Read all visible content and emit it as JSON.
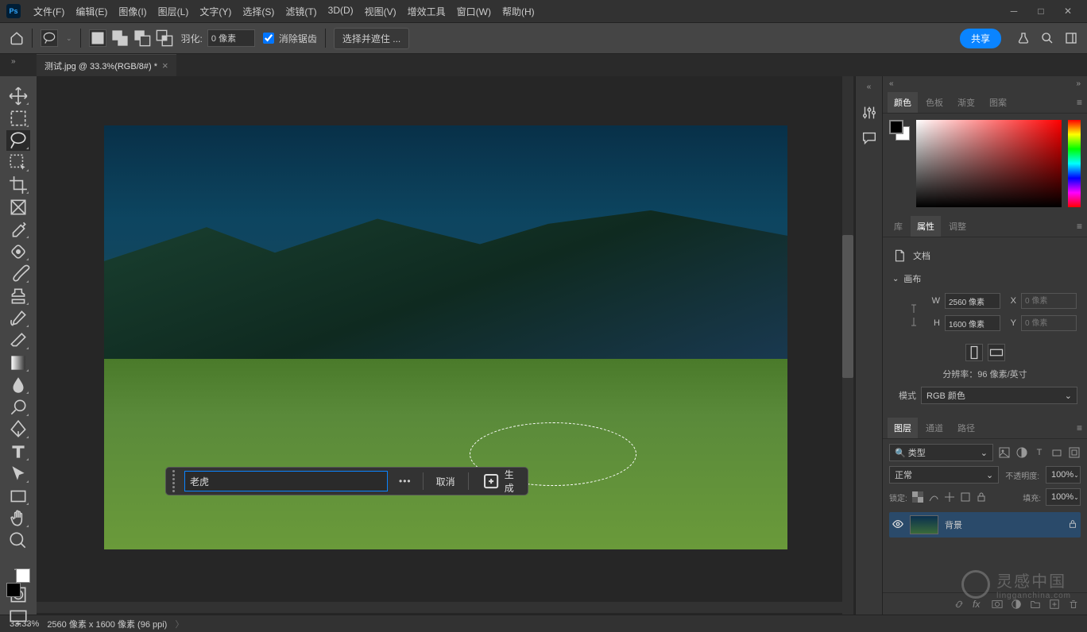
{
  "menu": {
    "file": "文件(F)",
    "edit": "编辑(E)",
    "image": "图像(I)",
    "layer": "图层(L)",
    "type": "文字(Y)",
    "select": "选择(S)",
    "filter": "滤镜(T)",
    "three_d": "3D(D)",
    "view": "视图(V)",
    "plugins": "增效工具",
    "window": "窗口(W)",
    "help": "帮助(H)"
  },
  "optionsbar": {
    "feather_label": "羽化:",
    "feather_value": "0 像素",
    "anti_alias": "消除锯齿",
    "select_mask": "选择并遮住 ...",
    "share": "共享"
  },
  "tab": {
    "title": "测试.jpg @ 33.3%(RGB/8#) *"
  },
  "gen_fill": {
    "input_value": "老虎",
    "cancel": "取消",
    "generate": "生成"
  },
  "panels": {
    "color": {
      "tab_color": "颜色",
      "tab_swatch": "色板",
      "tab_gradient": "渐变",
      "tab_pattern": "图案"
    },
    "props": {
      "tab_lib": "库",
      "tab_props": "属性",
      "tab_adjust": "调整",
      "doc_label": "文档",
      "canvas_section": "画布",
      "w_label": "W",
      "w_value": "2560 像素",
      "h_label": "H",
      "h_value": "1600 像素",
      "x_label": "X",
      "x_placeholder": "0 像素",
      "y_label": "Y",
      "y_placeholder": "0 像素",
      "resolution": "分辨率：96 像素/英寸",
      "mode_label": "模式",
      "mode_value": "RGB 颜色"
    },
    "layers": {
      "tab_layers": "图层",
      "tab_channels": "通道",
      "tab_paths": "路径",
      "kind_placeholder": "类型",
      "blend_mode": "正常",
      "opacity_label": "不透明度:",
      "opacity_value": "100%",
      "lock_label": "锁定:",
      "fill_label": "填充:",
      "fill_value": "100%",
      "layer1_name": "背景"
    }
  },
  "status": {
    "zoom": "33.33%",
    "doc_info": "2560 像素 x 1600 像素 (96 ppi)"
  },
  "watermark": {
    "main": "灵感中国",
    "sub": "lingganchina.com"
  }
}
